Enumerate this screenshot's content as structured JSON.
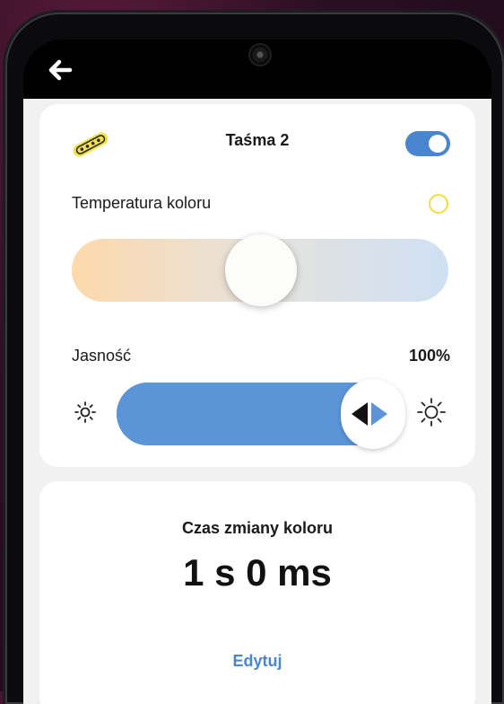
{
  "topbar": {
    "back_icon": "arrow-left-icon"
  },
  "card": {
    "strip_icon": "led-strip-icon",
    "title": "Taśma 2",
    "enabled": true,
    "temperature_label": "Temperatura koloru",
    "temperature_level": 0.5,
    "indicator_color": "#f3dc4a",
    "brightness_label": "Jasność",
    "brightness_value": "100%",
    "brightness_level": 1.0,
    "colors": {
      "accent": "#4a86cf",
      "slider": "#5b95d8",
      "warm": "#fdd9ad",
      "cool": "#cfe0f4"
    }
  },
  "transition": {
    "label": "Czas zmiany koloru",
    "value": "1 s 0 ms",
    "edit_label": "Edytuj"
  }
}
